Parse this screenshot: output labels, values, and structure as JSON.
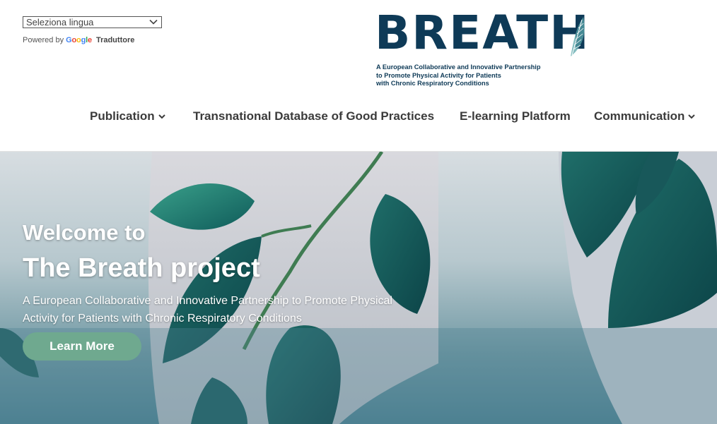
{
  "translate": {
    "select_value": "Seleziona lingua",
    "powered_by": "Powered by",
    "google": "Google",
    "service": "Traduttore"
  },
  "logo": {
    "word": "BREATH",
    "tagline_lines": [
      "A European Collaborative and Innovative Partnership",
      "to Promote Physical Activity for Patients",
      "with Chronic Respiratory Conditions"
    ]
  },
  "nav": {
    "items": [
      {
        "label": "Publication",
        "dropdown": true
      },
      {
        "label": "Transnational Database of Good Practices",
        "dropdown": false
      },
      {
        "label": "E-learning Platform",
        "dropdown": false
      },
      {
        "label": "Communication",
        "dropdown": true
      }
    ]
  },
  "hero": {
    "subtitle": "Welcome to",
    "title": "The Breath project",
    "description": "A European Collaborative and Innovative Partnership to Promote Physical Activity for Patients with Chronic Respiratory Conditions",
    "cta_label": "Learn More"
  },
  "colors": {
    "brand": "#0e3a57",
    "cta": "#6fa98f",
    "nav_text": "#3b3b3b"
  },
  "icons": [
    "chevron-down-icon",
    "google-logo",
    "leaf-wing-icon"
  ]
}
